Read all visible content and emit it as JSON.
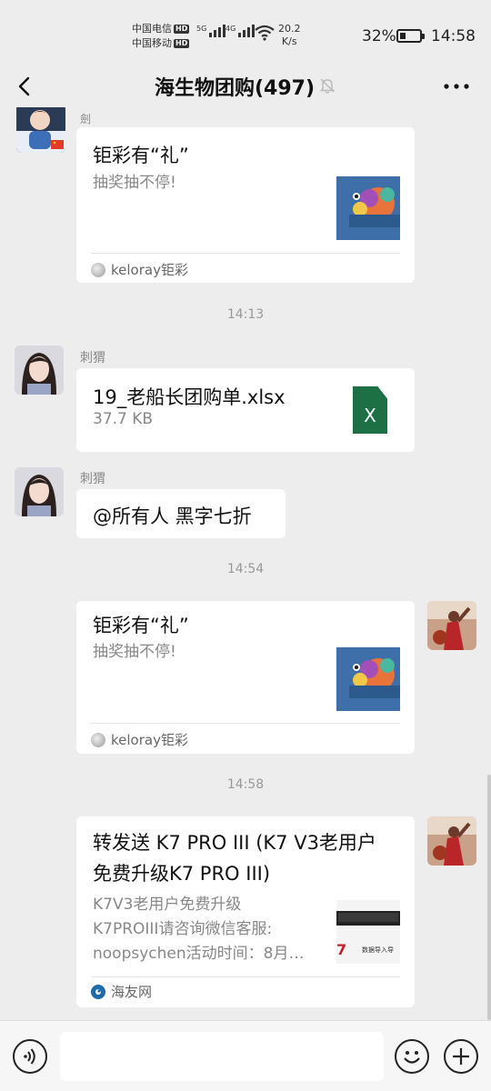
{
  "status_bar": {
    "carrier1": "中国电信",
    "carrier2": "中国移动",
    "hd_badge": "HD",
    "sig1_gen": "5G",
    "sig2_gen": "4G",
    "speed_value": "20.2",
    "speed_unit": "K/s",
    "battery": "32%",
    "battery_level": 0.32,
    "time": "14:58"
  },
  "header": {
    "title": "海生物团购(497)",
    "back_icon": "chevron-left-icon",
    "mute_icon": "bell-off-icon",
    "more_icon": "more-horizontal-icon"
  },
  "messages": {
    "m1": {
      "sender": "劍",
      "title": "钜彩有“礼”",
      "desc": "抽奖抽不停!",
      "source": "keloray钜彩"
    },
    "t1": "14:13",
    "m2": {
      "sender": "刺猬",
      "file_name": "19_老船长团购单.xlsx",
      "file_size": "37.7 KB",
      "file_icon_label": "X"
    },
    "m3": {
      "sender": "刺猬",
      "text": "@所有人  黑字七折"
    },
    "t2": "14:54",
    "m4": {
      "title": "钜彩有“礼”",
      "desc": "抽奖抽不停!",
      "source": "keloray钜彩"
    },
    "t3": "14:58",
    "m5": {
      "title_line1": "转发送 K7 PRO III (K7 V3老用户",
      "title_line2": "免费升级K7 PRO III)",
      "desc_line1": "K7V3老用户免费升级",
      "desc_line2": "K7PROIII请咨询微信客服:",
      "desc_line3": "noopsychen活动时间：8月…",
      "thumb_caption": "数据导入导",
      "source": "海友网"
    }
  },
  "composer": {
    "placeholder": "",
    "voice_icon": "voice-icon",
    "emoji_icon": "emoji-icon",
    "plus_icon": "plus-circle-icon"
  }
}
